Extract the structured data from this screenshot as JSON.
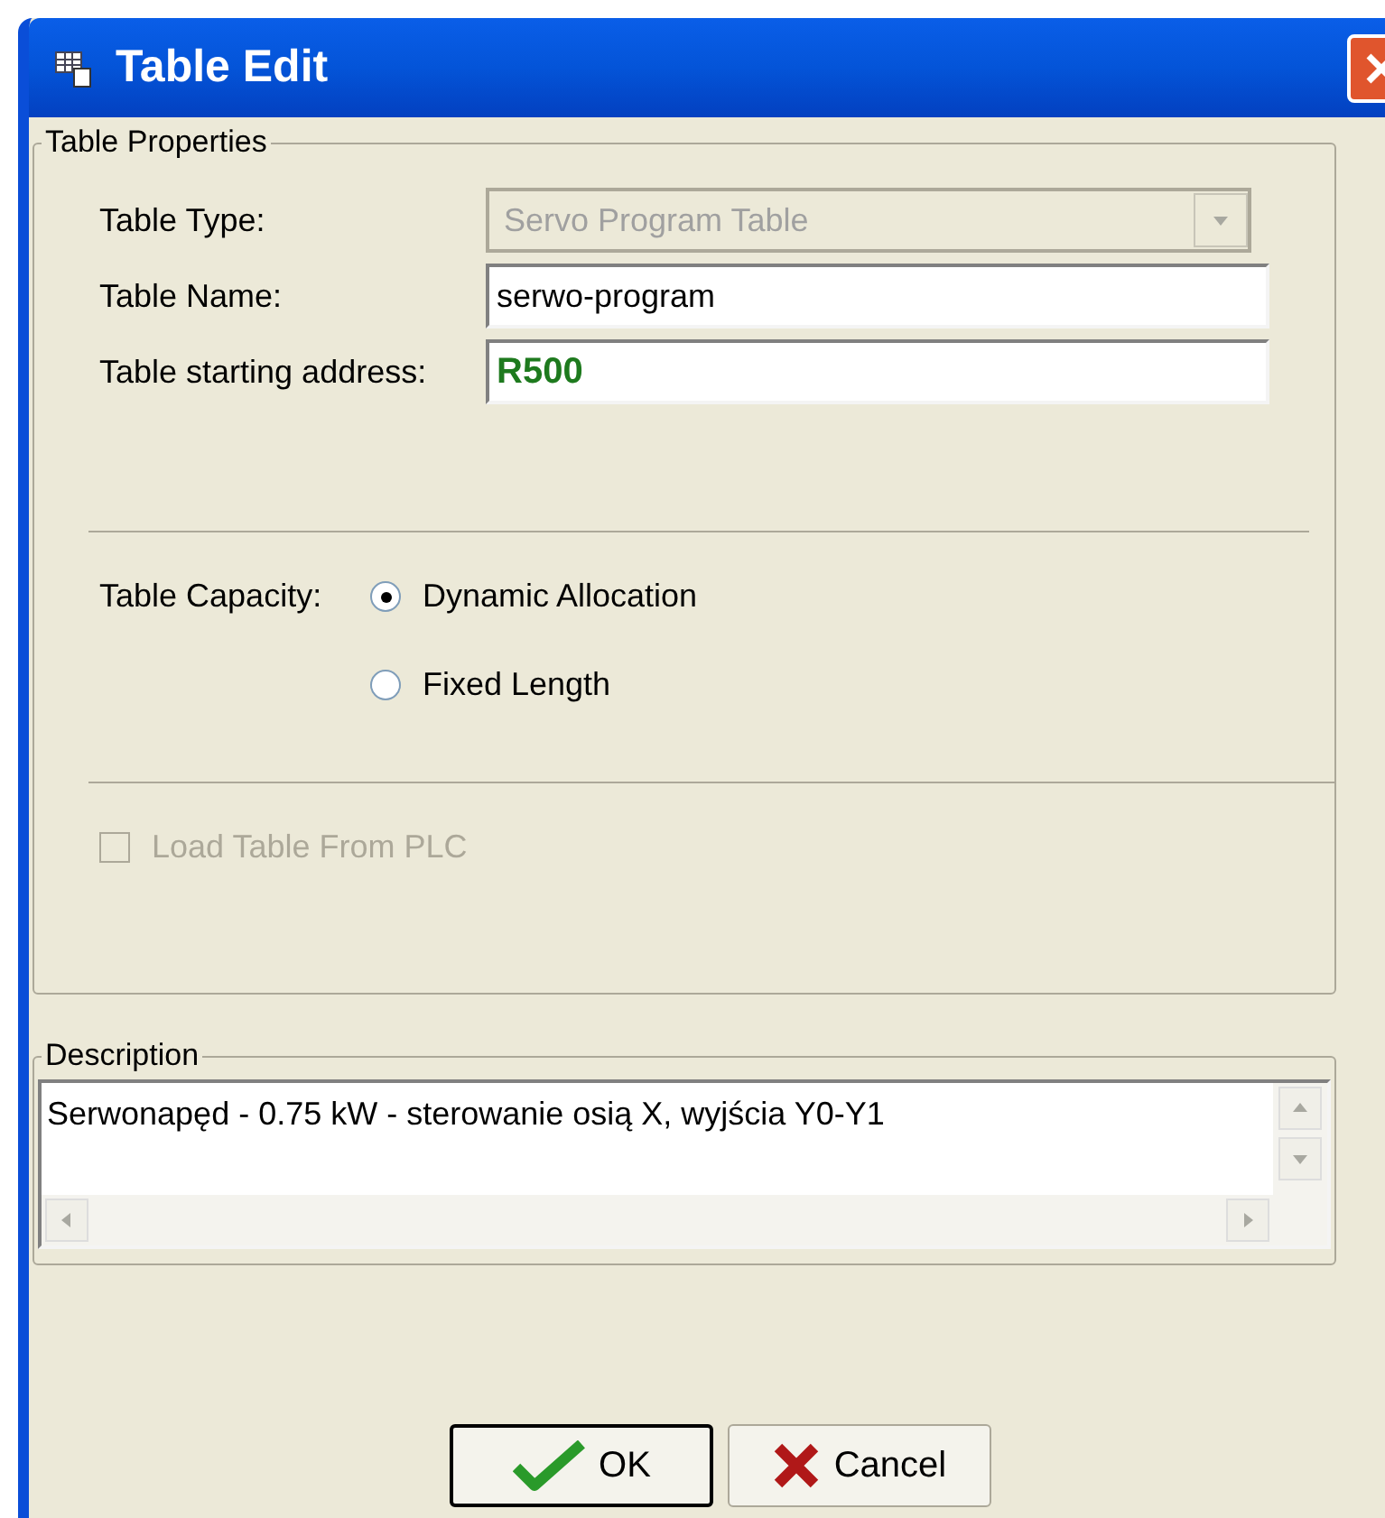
{
  "window": {
    "title": "Table Edit"
  },
  "properties": {
    "legend": "Table Properties",
    "table_type": {
      "label": "Table Type:",
      "value": "Servo Program Table",
      "disabled": true
    },
    "table_name": {
      "label": "Table Name:",
      "value": "serwo-program"
    },
    "start_address": {
      "label": "Table starting address:",
      "value": "R500"
    },
    "capacity": {
      "label": "Table Capacity:",
      "options": [
        {
          "label": "Dynamic Allocation",
          "selected": true
        },
        {
          "label": "Fixed Length",
          "selected": false
        }
      ]
    },
    "load_from_plc": {
      "label": "Load Table From PLC",
      "checked": false,
      "disabled": true
    }
  },
  "description": {
    "legend": "Description",
    "value": "Serwonapęd - 0.75 kW - sterowanie osią X, wyjścia Y0-Y1"
  },
  "buttons": [
    {
      "kind": "ok",
      "label": "OK"
    },
    {
      "kind": "cancel",
      "label": "Cancel"
    }
  ]
}
